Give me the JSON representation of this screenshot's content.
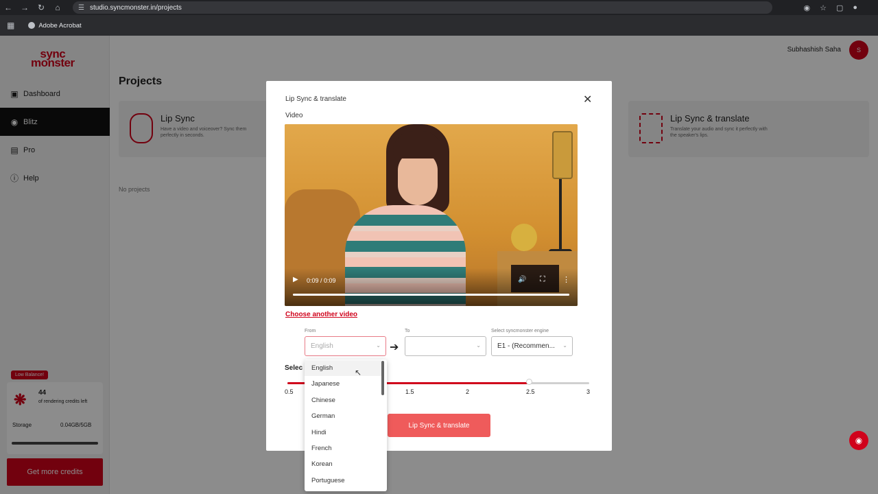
{
  "browser": {
    "url": "studio.syncmonster.in/projects",
    "bookmark": "Adobe Acrobat"
  },
  "sidebar": {
    "logo_top": "sync",
    "logo_bottom": "monster",
    "items": [
      {
        "label": "Dashboard",
        "icon": "dashboard-icon"
      },
      {
        "label": "Blitz",
        "icon": "blitz-icon",
        "active": true
      },
      {
        "label": "Pro",
        "icon": "pro-icon"
      },
      {
        "label": "Help",
        "icon": "help-icon"
      }
    ],
    "watermark_top": "sync",
    "watermark_bottom": "monster",
    "low_balance": "Low Balance!",
    "credits_count": "44",
    "credits_text": "of rendering credits left",
    "storage_label": "Storage",
    "storage_value": "0.04GB/5GB",
    "get_credits": "Get more credits"
  },
  "header": {
    "user_name": "Subhashish Saha",
    "avatar_initial": "S"
  },
  "main": {
    "page_title": "Projects",
    "cards": [
      {
        "title": "Lip Sync",
        "desc": "Have a video and voiceover? Sync them perfectly in seconds."
      },
      {
        "title": "Lip Sync & translate",
        "desc": "Translate your audio and sync it perfectly with the speaker's lips."
      }
    ],
    "no_projects": "No projects"
  },
  "modal": {
    "title": "Lip Sync & translate",
    "video_label": "Video",
    "video_time": "0:09 / 0:09",
    "video_progress": 1.0,
    "choose_link": "Choose another video",
    "from_label": "From",
    "from_placeholder": "English",
    "to_label": "To",
    "to_value": "",
    "engine_label": "Select syncmonster engine",
    "engine_value": "E1 - (Recommen...",
    "select_label": "Selec",
    "slider": {
      "ticks": [
        "0.5",
        "1",
        "1.5",
        "2",
        "2.5",
        "3"
      ],
      "value": 2.5,
      "min": 0.5,
      "max": 3
    },
    "submit": "Lip Sync & translate"
  },
  "dropdown": {
    "options": [
      "English",
      "Japanese",
      "Chinese",
      "German",
      "Hindi",
      "French",
      "Korean",
      "Portuguese"
    ],
    "selected": "English"
  },
  "colors": {
    "brand": "#d0021b",
    "button": "#ef5b5b"
  }
}
